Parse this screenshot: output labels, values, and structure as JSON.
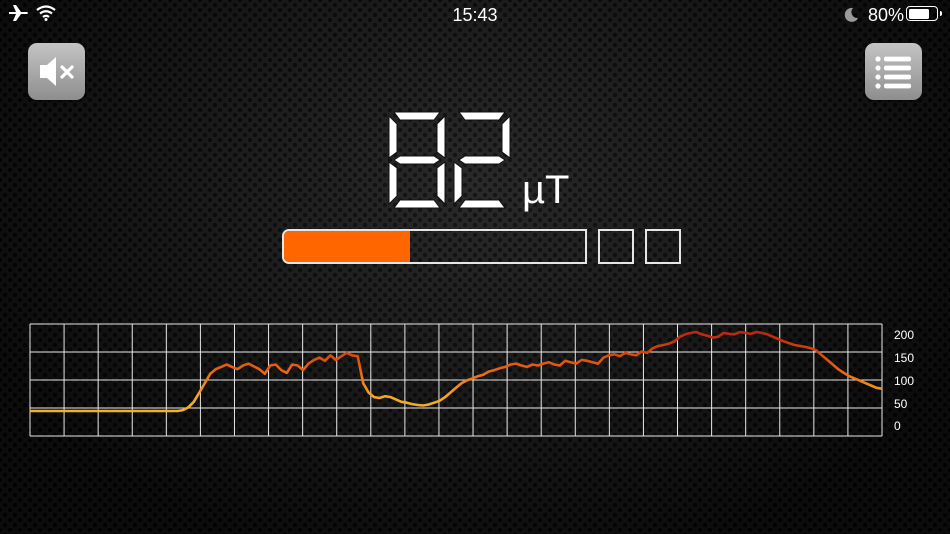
{
  "status_bar": {
    "time": "15:43",
    "battery_percent": "80%",
    "battery_level": 0.8,
    "icons": [
      "airplane-icon",
      "wifi-icon",
      "moon-icon",
      "battery-icon"
    ]
  },
  "controls": {
    "mute_icon": "speaker-muted-icon",
    "menu_icon": "list-icon"
  },
  "reading": {
    "value": "82",
    "unit": "µT"
  },
  "level": {
    "fraction": 0.42,
    "fill_color": "#ff6600",
    "extra_boxes": 2
  },
  "chart_data": {
    "type": "line",
    "y_ticks": [
      "200",
      "150",
      "100",
      "50",
      "0"
    ],
    "ylim": [
      0,
      200
    ],
    "grid": true,
    "colors": [
      "#f2c418",
      "#f5a623",
      "#e8600e",
      "#b01a12"
    ],
    "series": [
      {
        "values": [
          30,
          30,
          30,
          30,
          30,
          30,
          30,
          30,
          30,
          30,
          30,
          30,
          30,
          30,
          30,
          30,
          30,
          30,
          30,
          30,
          30,
          30,
          30,
          30,
          30,
          30,
          30,
          30,
          32,
          38,
          50,
          70,
          90,
          110,
          120,
          125,
          130,
          125,
          120,
          128,
          132,
          126,
          120,
          110,
          128,
          130,
          118,
          112,
          130,
          128,
          118,
          132,
          140,
          145,
          138,
          150,
          140,
          148,
          155,
          150,
          148,
          90,
          70,
          60,
          58,
          62,
          60,
          55,
          50,
          48,
          45,
          43,
          42,
          44,
          48,
          52,
          60,
          70,
          80,
          90,
          96,
          100,
          105,
          108,
          115,
          118,
          122,
          125,
          130,
          132,
          128,
          125,
          130,
          128,
          132,
          135,
          130,
          128,
          138,
          135,
          132,
          140,
          138,
          135,
          132,
          145,
          150,
          152,
          148,
          155,
          152,
          150,
          158,
          155,
          165,
          170,
          172,
          175,
          180,
          190,
          195,
          198,
          200,
          195,
          192,
          188,
          190,
          198,
          196,
          195,
          200,
          198,
          196,
          200,
          198,
          195,
          190,
          185,
          180,
          176,
          172,
          170,
          168,
          165,
          160,
          150,
          140,
          130,
          120,
          112,
          105,
          100,
          95,
          90,
          85,
          80,
          78
        ]
      }
    ]
  }
}
